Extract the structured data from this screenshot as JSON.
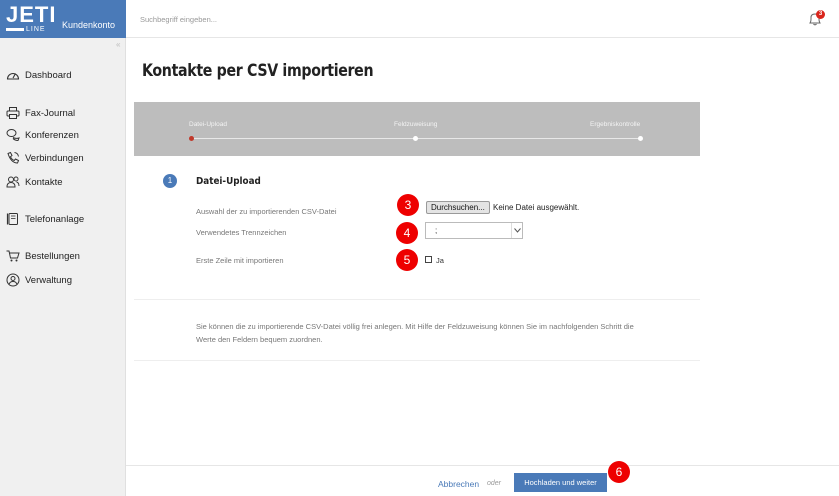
{
  "sidebar": {
    "logo_text": "JETI",
    "logo_subtext": "LINE",
    "account_label": "Kundenkonto",
    "collapse_glyph": "«",
    "items": [
      {
        "label": "Dashboard",
        "icon": "dashboard-gauge-icon"
      },
      {
        "label": "Fax-Journal",
        "icon": "printer-icon"
      },
      {
        "label": "Konferenzen",
        "icon": "conference-chat-icon"
      },
      {
        "label": "Verbindungen",
        "icon": "phone-icon"
      },
      {
        "label": "Kontakte",
        "icon": "contacts-icon"
      },
      {
        "label": "Telefonanlage",
        "icon": "phone-system-icon"
      },
      {
        "label": "Bestellungen",
        "icon": "cart-icon"
      },
      {
        "label": "Verwaltung",
        "icon": "user-circle-icon"
      }
    ]
  },
  "header": {
    "search_placeholder": "Suchbegriff eingeben...",
    "notification_count": "3"
  },
  "page": {
    "title": "Kontakte per CSV importieren"
  },
  "stepper": {
    "steps": [
      {
        "label": "Datei-Upload",
        "active": true
      },
      {
        "label": "Feldzuweisung",
        "active": false
      },
      {
        "label": "Ergebniskontrolle",
        "active": false
      }
    ]
  },
  "section": {
    "number": "1",
    "title": "Datei-Upload"
  },
  "form": {
    "file_label": "Auswahl der zu importierenden CSV-Datei",
    "browse_label": "Durchsuchen...",
    "no_file_text": "Keine Datei ausgewählt.",
    "separator_label": "Verwendetes Trennzeichen",
    "separator_value": ";",
    "first_row_label": "Erste Zeile mit importieren",
    "first_row_option": "Ja",
    "first_row_checked": false
  },
  "markers": {
    "m3": "3",
    "m4": "4",
    "m5": "5",
    "m6": "6"
  },
  "info": {
    "text": "Sie können die zu importierende CSV-Datei völlig frei anlegen. Mit Hilfe der Feldzuweisung können Sie im nachfolgenden Schritt die Werte den Feldern bequem zuordnen."
  },
  "footer": {
    "cancel_label": "Abbrechen",
    "or_label": "oder",
    "submit_label": "Hochladen und weiter"
  },
  "colors": {
    "brand_blue": "#4a7ab8",
    "marker_red": "#ee0000",
    "stepper_gray": "#bdbdbd"
  }
}
